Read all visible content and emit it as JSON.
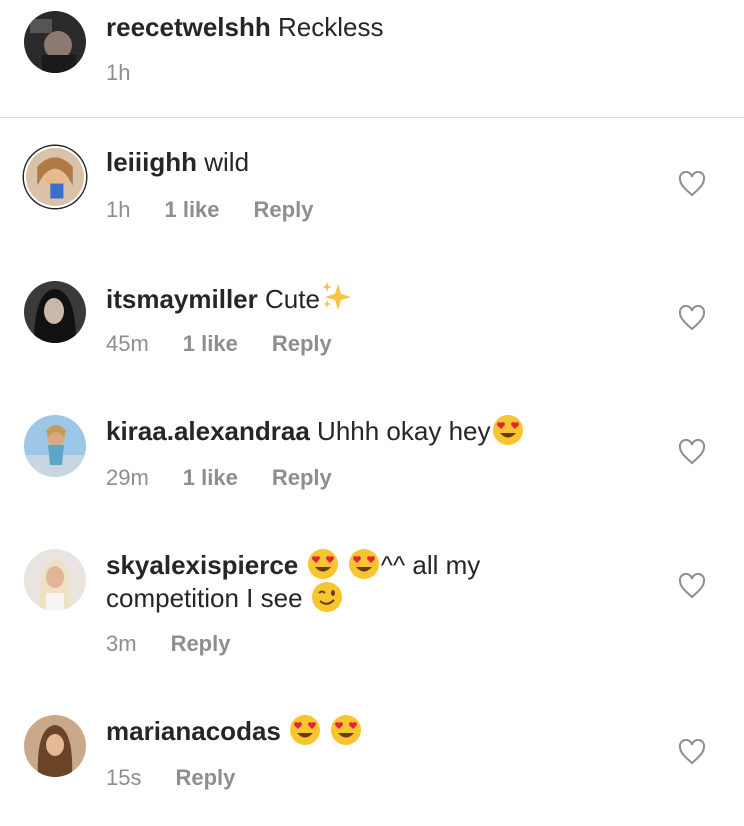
{
  "caption": {
    "username": "reecetwelshh",
    "text": "Reckless",
    "time": "1h"
  },
  "comments": [
    {
      "username": "leiiighh",
      "text": "wild",
      "time": "1h",
      "likes": "1 like",
      "reply": "Reply"
    },
    {
      "username": "itsmaymiller",
      "text": "Cute",
      "time": "45m",
      "likes": "1 like",
      "reply": "Reply"
    },
    {
      "username": "kiraa.alexandraa",
      "text": "Uhhh okay hey",
      "time": "29m",
      "likes": "1 like",
      "reply": "Reply"
    },
    {
      "username": "skyalexispierce",
      "text_a": "^^ all my",
      "text_b": "competition I see",
      "time": "3m",
      "reply": "Reply"
    },
    {
      "username": "marianacodas",
      "time": "15s",
      "reply": "Reply"
    }
  ],
  "icons": {
    "heart": "heart-outline-icon",
    "heart_eyes": "heart-eyes-emoji",
    "wink": "wink-emoji",
    "sparkles": "sparkles-emoji"
  },
  "colors": {
    "text": "#262626",
    "meta": "#8e8e8e",
    "divider": "#dbdbdb",
    "emoji_face": "#f7c530",
    "emoji_heart": "#e8213a",
    "sparkle": "#f6c343"
  }
}
